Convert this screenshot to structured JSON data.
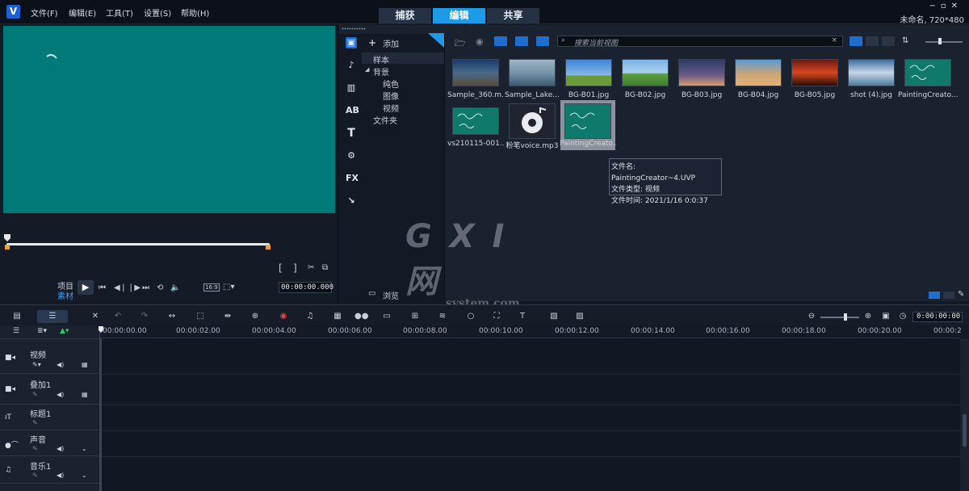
{
  "app": {
    "menu": [
      "文件(F)",
      "编辑(E)",
      "工具(T)",
      "设置(S)",
      "帮助(H)"
    ],
    "mode_tabs": [
      {
        "label": "捕获",
        "active": false
      },
      {
        "label": "编辑",
        "active": true
      },
      {
        "label": "共享",
        "active": false
      }
    ],
    "window_controls": [
      "−",
      "▫",
      "✕"
    ],
    "project_info": "未命名, 720*480",
    "accent": "#1e9be6"
  },
  "preview": {
    "screen_color": "#007a78",
    "mode_labels": [
      "项目",
      "素材"
    ],
    "aspect": "16:9",
    "timecode": "00:00:00.000",
    "trim_in": "[",
    "trim_out": "]"
  },
  "library": {
    "add_label": "添加",
    "tree": {
      "sample": "样本",
      "background": "背景",
      "solid": "纯色",
      "image": "图像",
      "video": "视频",
      "folder": "文件夹"
    },
    "browse_label": "浏览",
    "search_placeholder": "搜索当前视图",
    "items": [
      {
        "name": "Sample_360.m...",
        "color": "#3a5a7a"
      },
      {
        "name": "Sample_Lake...",
        "color": "#8aa4b6"
      },
      {
        "name": "BG-B01.jpg",
        "color": "#4f8fce"
      },
      {
        "name": "BG-B02.jpg",
        "color": "#5ca042"
      },
      {
        "name": "BG-B03.jpg",
        "color": "#3d4b6e"
      },
      {
        "name": "BG-B04.jpg",
        "color": "#d59a5d"
      },
      {
        "name": "BG-B05.jpg",
        "color": "#b5301e"
      },
      {
        "name": "shot (4).jpg",
        "color": "#5f8fb4"
      },
      {
        "name": "PaintingCreato...",
        "color": "#0f7a6c"
      },
      {
        "name": "vs210115-001...",
        "color": "#0f7a6c"
      },
      {
        "name": "粉笔voice.mp3",
        "color": "#1f2430"
      },
      {
        "name": "PaintingCreato...",
        "color": "#0f7a6c"
      }
    ],
    "tooltip": {
      "line1": "文件名: PaintingCreator~4.UVP",
      "line2": "文件类型: 视频",
      "line3": "文件时间: 2021/1/16 0:0:37"
    }
  },
  "timeline": {
    "timecode": "0:00:00:00",
    "ruler": [
      "00:00:00.00",
      "00:00:02.00",
      "00:00:04.00",
      "00:00:06.00",
      "00:00:08.00",
      "00:00:10.00",
      "00:00:12.00",
      "00:00:14.00",
      "00:00:16.00",
      "00:00:18.00",
      "00:00:20.00",
      "00:00:2"
    ],
    "tracks": [
      {
        "name": "视频"
      },
      {
        "name": "叠加1"
      },
      {
        "name": "标题1"
      },
      {
        "name": "声音"
      },
      {
        "name": "音乐1"
      }
    ]
  },
  "watermark": {
    "line1": "G X I 网",
    "line2": "system.com"
  }
}
